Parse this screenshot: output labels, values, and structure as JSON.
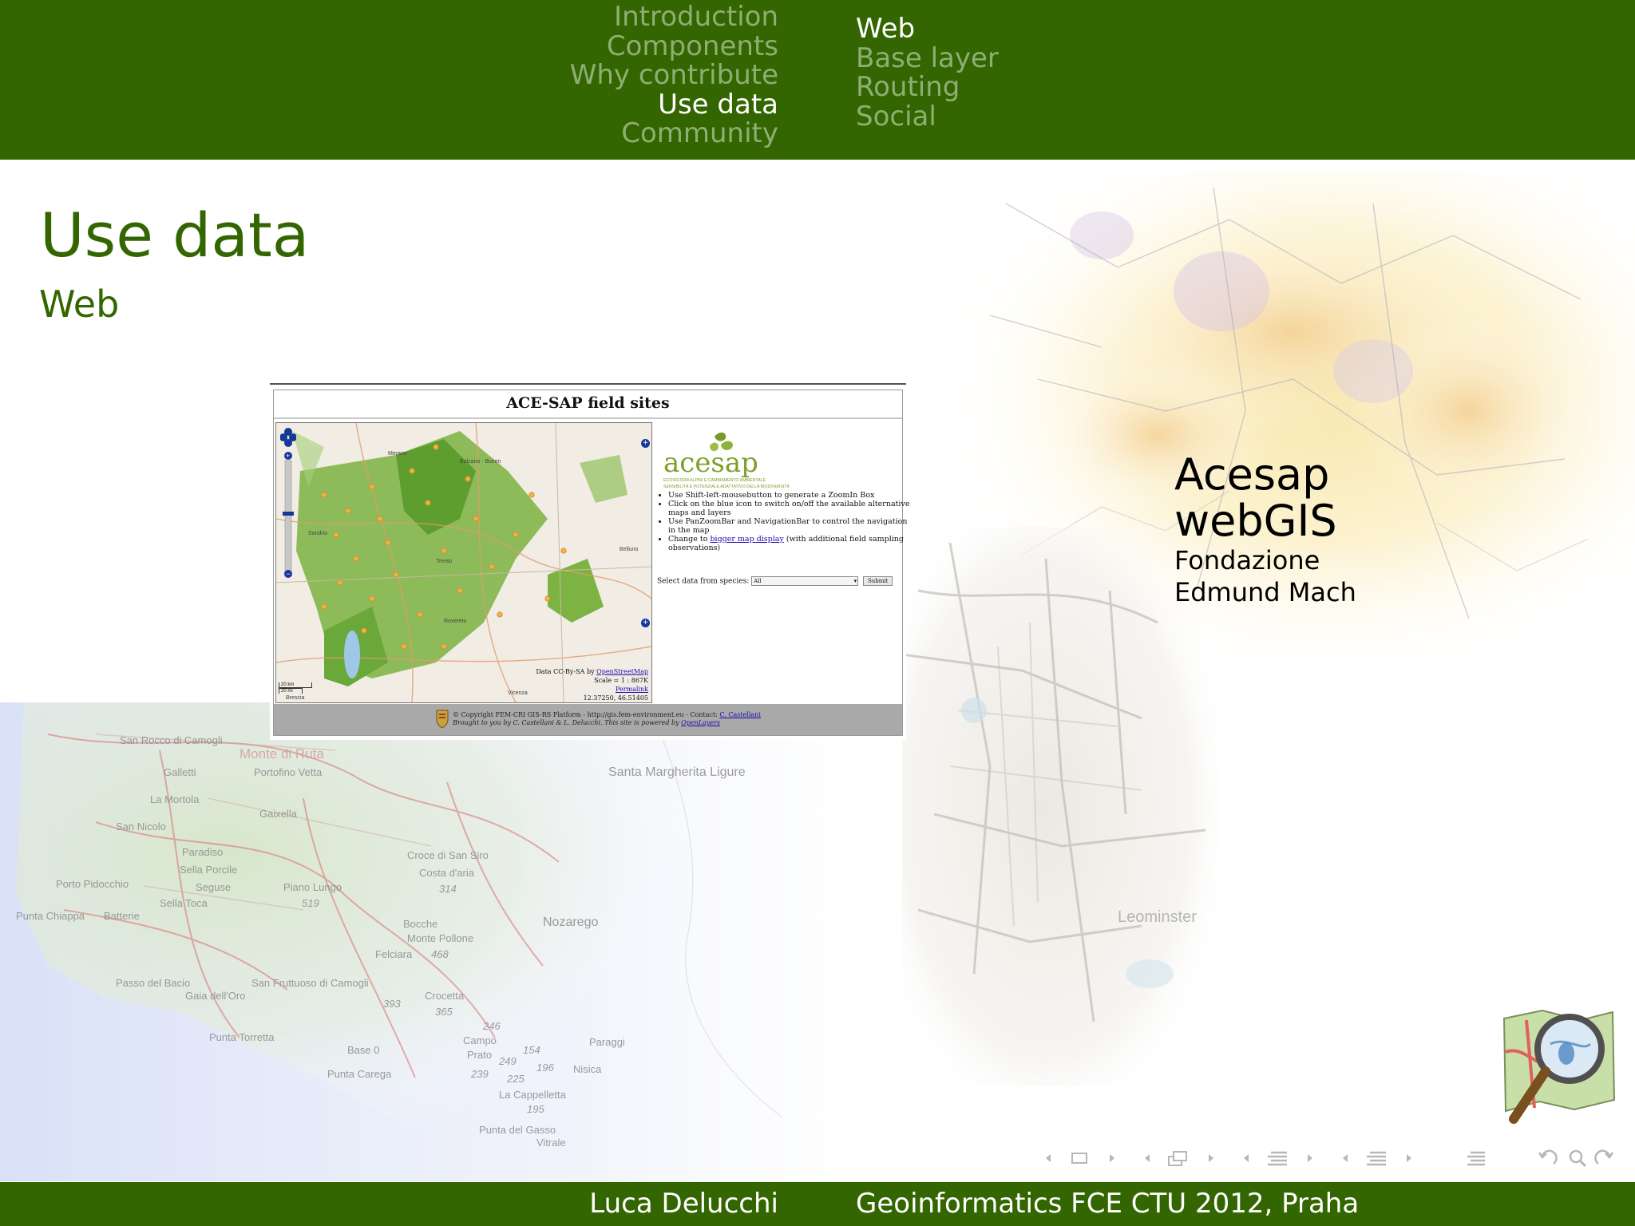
{
  "header": {
    "sections": [
      {
        "label": "Introduction",
        "active": false
      },
      {
        "label": "Components",
        "active": false
      },
      {
        "label": "Why contribute",
        "active": false
      },
      {
        "label": "Use data",
        "active": true
      },
      {
        "label": "Community",
        "active": false
      }
    ],
    "subsections": [
      {
        "label": "Web",
        "active": true
      },
      {
        "label": "Base layer",
        "active": false
      },
      {
        "label": "Routing",
        "active": false
      },
      {
        "label": "Social",
        "active": false
      }
    ]
  },
  "slide": {
    "title": "Use data",
    "subtitle": "Web"
  },
  "screenshot": {
    "page_title": "ACE-SAP field sites",
    "logo_text": "acesap",
    "logo_tagline_1": "ECOSISTEMI ALPINI E CAMBIAMENTO AMBIENTALE",
    "logo_tagline_2": "SENSIBILITÀ E POTENZIALE ADATTATIVO DELLA BIODIVERSITÀ",
    "instructions": [
      "Use Shift-left-mousebutton to generate a ZoomIn Box",
      "Click on the blue icon to switch on/off the available alternative maps and layers",
      "Use PanZoomBar and NavigationBar to control the navigation in the map",
      "Change to bigger map display (with additional field sampling observations)"
    ],
    "bigger_map_link": "bigger map display",
    "select_label": "Select data from species:",
    "select_value": "All",
    "submit_label": "Submit",
    "attribution_prefix": "Data CC-By-SA by",
    "attribution_link": "OpenStreetMap",
    "scale": "Scale = 1 : 867K",
    "permalink": "Permalink",
    "coords": "12.37250, 46.51405",
    "scalebar_top": "20 km",
    "scalebar_bottom": "20 mi",
    "footer_line1": "© Copyright FEM-CRI GIS-RS Platform - http://gis.fem-environment.eu - Contact:",
    "footer_contact": "C. Castellani",
    "footer_line2": "Brought to you by C. Castellani & L. Delucchi. This site is powered by",
    "footer_powered": "OpenLayers",
    "map_places": [
      "Bolzano - Bozen",
      "Trento",
      "Belluno",
      "Vicenza",
      "Brescia",
      "Sondrio",
      "Merano",
      "Rovereto"
    ]
  },
  "caption": {
    "line1": "Acesap",
    "line2": "webGIS",
    "line3": "Fondazione",
    "line4": "Edmund Mach"
  },
  "background_labels": [
    "San Rocco di Camogli",
    "Monte di Ruta",
    "Galletti",
    "Portofino Vetta",
    "La Mortola",
    "Gaixella",
    "San Nicolo",
    "Paradiso",
    "Sella Porcile",
    "Porto Pidocchio",
    "Seguse",
    "Piano Lungo",
    "519",
    "Croce di San Siro",
    "Costa d'aria",
    "314",
    "Sella Toca",
    "Punta Chiappa",
    "Batterie",
    "Bocche",
    "Monte Pollone",
    "Felciara",
    "468",
    "Passo del Bacio",
    "San Fruttuoso di Camogli",
    "Gaia dell'Oro",
    "Crocetta",
    "365",
    "393",
    "Punta Torretta",
    "Base 0",
    "Santa Margherita Ligure",
    "Nozarego",
    "Punta Carega",
    "Campo",
    "Prato",
    "246",
    "154",
    "249",
    "196",
    "239",
    "225",
    "La Cappelletta",
    "195",
    "Punta del Gassо",
    "Vitrale",
    "Nisica",
    "Paraggi",
    "Leominster"
  ],
  "footer": {
    "author": "Luca Delucchi",
    "conference": "Geoinformatics FCE CTU 2012, Praha"
  },
  "colors": {
    "brand_green": "#336600",
    "inactive_nav": "#8fae74",
    "link": "#1a0dab"
  }
}
